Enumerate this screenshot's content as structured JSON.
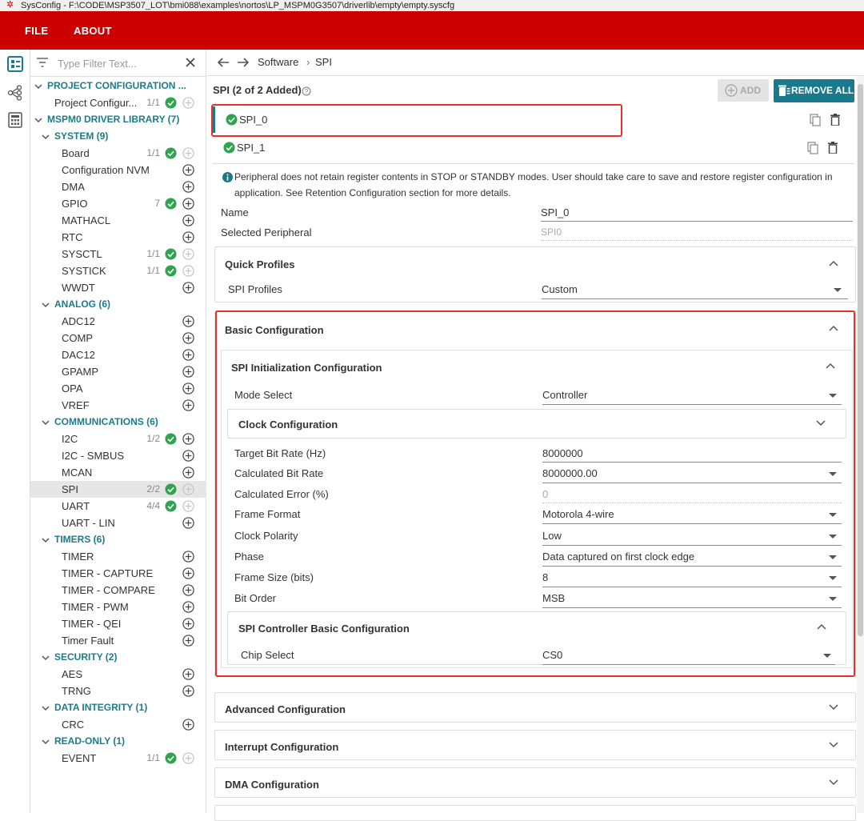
{
  "window": {
    "title": "SysConfig - F:\\CODE\\MSP3507_LOT\\bmi088\\examples\\nortos\\LP_MSPM0G3507\\driverlib\\empty\\empty.syscfg"
  },
  "menu": {
    "file": "FILE",
    "about": "ABOUT"
  },
  "colors": {
    "brand_red": "#cc0000",
    "accent_teal": "#197a8e",
    "category_teal": "#1d7c8a",
    "check_green": "#2da44e",
    "highlight_red": "#e8302b"
  },
  "filter": {
    "placeholder": "Type Filter Text..."
  },
  "tree": [
    {
      "kind": "cat",
      "level": 0,
      "label": "PROJECT CONFIGURATION ..."
    },
    {
      "kind": "item",
      "level": 1,
      "label": "Project Configur...",
      "count": "1/1",
      "check": true,
      "add": "disabled"
    },
    {
      "kind": "cat",
      "level": 0,
      "label": "MSPM0 DRIVER LIBRARY (7)"
    },
    {
      "kind": "cat",
      "level": 1,
      "label": "SYSTEM (9)"
    },
    {
      "kind": "item",
      "level": 2,
      "label": "Board",
      "count": "1/1",
      "check": true,
      "add": "disabled"
    },
    {
      "kind": "item",
      "level": 2,
      "label": "Configuration NVM",
      "count": "",
      "check": false,
      "add": "enabled"
    },
    {
      "kind": "item",
      "level": 2,
      "label": "DMA",
      "count": "",
      "check": false,
      "add": "enabled"
    },
    {
      "kind": "item",
      "level": 2,
      "label": "GPIO",
      "count": "7",
      "check": true,
      "add": "enabled"
    },
    {
      "kind": "item",
      "level": 2,
      "label": "MATHACL",
      "count": "",
      "check": false,
      "add": "enabled"
    },
    {
      "kind": "item",
      "level": 2,
      "label": "RTC",
      "count": "",
      "check": false,
      "add": "enabled"
    },
    {
      "kind": "item",
      "level": 2,
      "label": "SYSCTL",
      "count": "1/1",
      "check": true,
      "add": "disabled"
    },
    {
      "kind": "item",
      "level": 2,
      "label": "SYSTICK",
      "count": "1/1",
      "check": true,
      "add": "disabled"
    },
    {
      "kind": "item",
      "level": 2,
      "label": "WWDT",
      "count": "",
      "check": false,
      "add": "enabled"
    },
    {
      "kind": "cat",
      "level": 1,
      "label": "ANALOG (6)"
    },
    {
      "kind": "item",
      "level": 2,
      "label": "ADC12",
      "count": "",
      "check": false,
      "add": "enabled"
    },
    {
      "kind": "item",
      "level": 2,
      "label": "COMP",
      "count": "",
      "check": false,
      "add": "enabled"
    },
    {
      "kind": "item",
      "level": 2,
      "label": "DAC12",
      "count": "",
      "check": false,
      "add": "enabled"
    },
    {
      "kind": "item",
      "level": 2,
      "label": "GPAMP",
      "count": "",
      "check": false,
      "add": "enabled"
    },
    {
      "kind": "item",
      "level": 2,
      "label": "OPA",
      "count": "",
      "check": false,
      "add": "enabled"
    },
    {
      "kind": "item",
      "level": 2,
      "label": "VREF",
      "count": "",
      "check": false,
      "add": "enabled"
    },
    {
      "kind": "cat",
      "level": 1,
      "label": "COMMUNICATIONS (6)"
    },
    {
      "kind": "item",
      "level": 2,
      "label": "I2C",
      "count": "1/2",
      "check": true,
      "add": "enabled"
    },
    {
      "kind": "item",
      "level": 2,
      "label": "I2C - SMBUS",
      "count": "",
      "check": false,
      "add": "enabled"
    },
    {
      "kind": "item",
      "level": 2,
      "label": "MCAN",
      "count": "",
      "check": false,
      "add": "enabled"
    },
    {
      "kind": "item",
      "level": 2,
      "label": "SPI",
      "count": "2/2",
      "check": true,
      "add": "disabled",
      "selected": true
    },
    {
      "kind": "item",
      "level": 2,
      "label": "UART",
      "count": "4/4",
      "check": true,
      "add": "disabled"
    },
    {
      "kind": "item",
      "level": 2,
      "label": "UART - LIN",
      "count": "",
      "check": false,
      "add": "enabled"
    },
    {
      "kind": "cat",
      "level": 1,
      "label": "TIMERS (6)"
    },
    {
      "kind": "item",
      "level": 2,
      "label": "TIMER",
      "count": "",
      "check": false,
      "add": "enabled"
    },
    {
      "kind": "item",
      "level": 2,
      "label": "TIMER - CAPTURE",
      "count": "",
      "check": false,
      "add": "enabled"
    },
    {
      "kind": "item",
      "level": 2,
      "label": "TIMER - COMPARE",
      "count": "",
      "check": false,
      "add": "enabled"
    },
    {
      "kind": "item",
      "level": 2,
      "label": "TIMER - PWM",
      "count": "",
      "check": false,
      "add": "enabled"
    },
    {
      "kind": "item",
      "level": 2,
      "label": "TIMER - QEI",
      "count": "",
      "check": false,
      "add": "enabled"
    },
    {
      "kind": "item",
      "level": 2,
      "label": "Timer Fault",
      "count": "",
      "check": false,
      "add": "enabled"
    },
    {
      "kind": "cat",
      "level": 1,
      "label": "SECURITY (2)"
    },
    {
      "kind": "item",
      "level": 2,
      "label": "AES",
      "count": "",
      "check": false,
      "add": "enabled"
    },
    {
      "kind": "item",
      "level": 2,
      "label": "TRNG",
      "count": "",
      "check": false,
      "add": "enabled"
    },
    {
      "kind": "cat",
      "level": 1,
      "label": "DATA INTEGRITY (1)"
    },
    {
      "kind": "item",
      "level": 2,
      "label": "CRC",
      "count": "",
      "check": false,
      "add": "enabled"
    },
    {
      "kind": "cat",
      "level": 1,
      "label": "READ-ONLY (1)"
    },
    {
      "kind": "item",
      "level": 2,
      "label": "EVENT",
      "count": "1/1",
      "check": true,
      "add": "disabled"
    }
  ],
  "breadcrumb": {
    "software": "Software",
    "sep": "›",
    "spi": "SPI"
  },
  "module": {
    "title": "SPI (2 of 2 Added)",
    "add_label": "ADD",
    "remove_all_label": "REMOVE ALL",
    "instances": [
      "SPI_0",
      "SPI_1"
    ],
    "notice": "Peripheral does not retain register contents in STOP or STANDBY modes. User should take care to save and restore register configuration in application. See Retention Configuration section for more details."
  },
  "fields": {
    "name": {
      "label": "Name",
      "value": "SPI_0"
    },
    "selected_peripheral": {
      "label": "Selected Peripheral",
      "value": "SPI0"
    }
  },
  "quick_profiles": {
    "title": "Quick Profiles",
    "spi_profiles": {
      "label": "SPI Profiles",
      "value": "Custom"
    }
  },
  "basic": {
    "title": "Basic Configuration",
    "init_title": "SPI Initialization Configuration",
    "mode_select": {
      "label": "Mode Select",
      "value": "Controller"
    },
    "clock_title": "Clock Configuration",
    "target_bit_rate": {
      "label": "Target Bit Rate (Hz)",
      "value": "8000000"
    },
    "calculated_bit_rate": {
      "label": "Calculated Bit Rate",
      "value": "8000000.00"
    },
    "calculated_error": {
      "label": "Calculated Error (%)",
      "value": "0"
    },
    "frame_format": {
      "label": "Frame Format",
      "value": "Motorola 4-wire"
    },
    "clock_polarity": {
      "label": "Clock Polarity",
      "value": "Low"
    },
    "phase": {
      "label": "Phase",
      "value": "Data captured on first clock edge"
    },
    "frame_size": {
      "label": "Frame Size (bits)",
      "value": "8"
    },
    "bit_order": {
      "label": "Bit Order",
      "value": "MSB"
    },
    "controller_title": "SPI Controller Basic Configuration",
    "chip_select": {
      "label": "Chip Select",
      "value": "CS0"
    }
  },
  "collapsed_sections": {
    "advanced": "Advanced Configuration",
    "interrupt": "Interrupt Configuration",
    "dma": "DMA Configuration"
  }
}
